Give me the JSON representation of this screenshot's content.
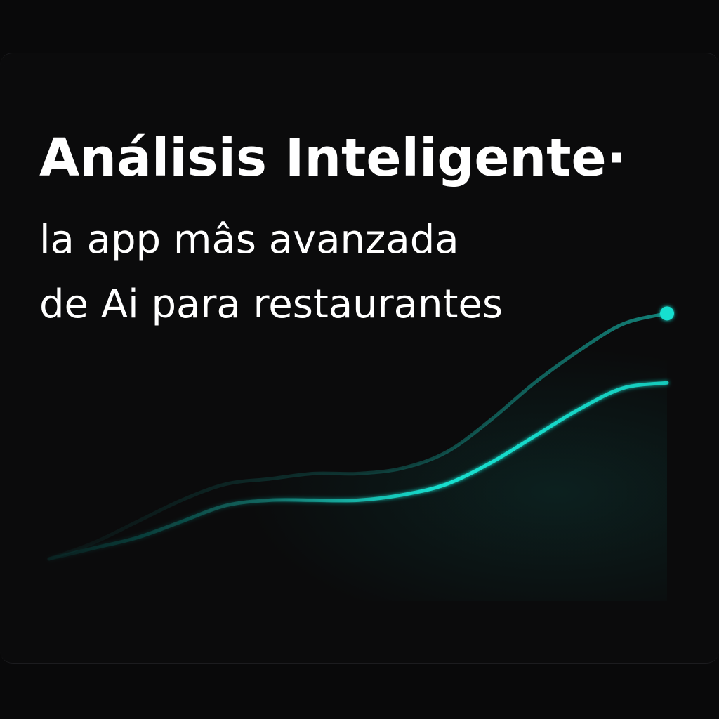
{
  "hero": {
    "title": "Análisis Inteligente·",
    "subtitle_line1": "la app mâs avanzada",
    "subtitle_line2": "de Ai para restaurantes"
  },
  "colors": {
    "background": "#09090a",
    "card": "#0b0b0c",
    "accent": "#19e0d0",
    "text": "#ffffff"
  },
  "chart_data": {
    "type": "line",
    "series": [
      {
        "values": [
          0,
          2,
          4,
          7,
          10,
          11,
          11,
          11,
          12,
          14,
          18,
          23,
          28,
          32,
          33
        ]
      },
      {
        "values": [
          0,
          3,
          7,
          11,
          14,
          15,
          16,
          16,
          17,
          20,
          26,
          33,
          39,
          44,
          46
        ]
      }
    ],
    "ylim": [
      0,
      50
    ],
    "grid": false
  }
}
